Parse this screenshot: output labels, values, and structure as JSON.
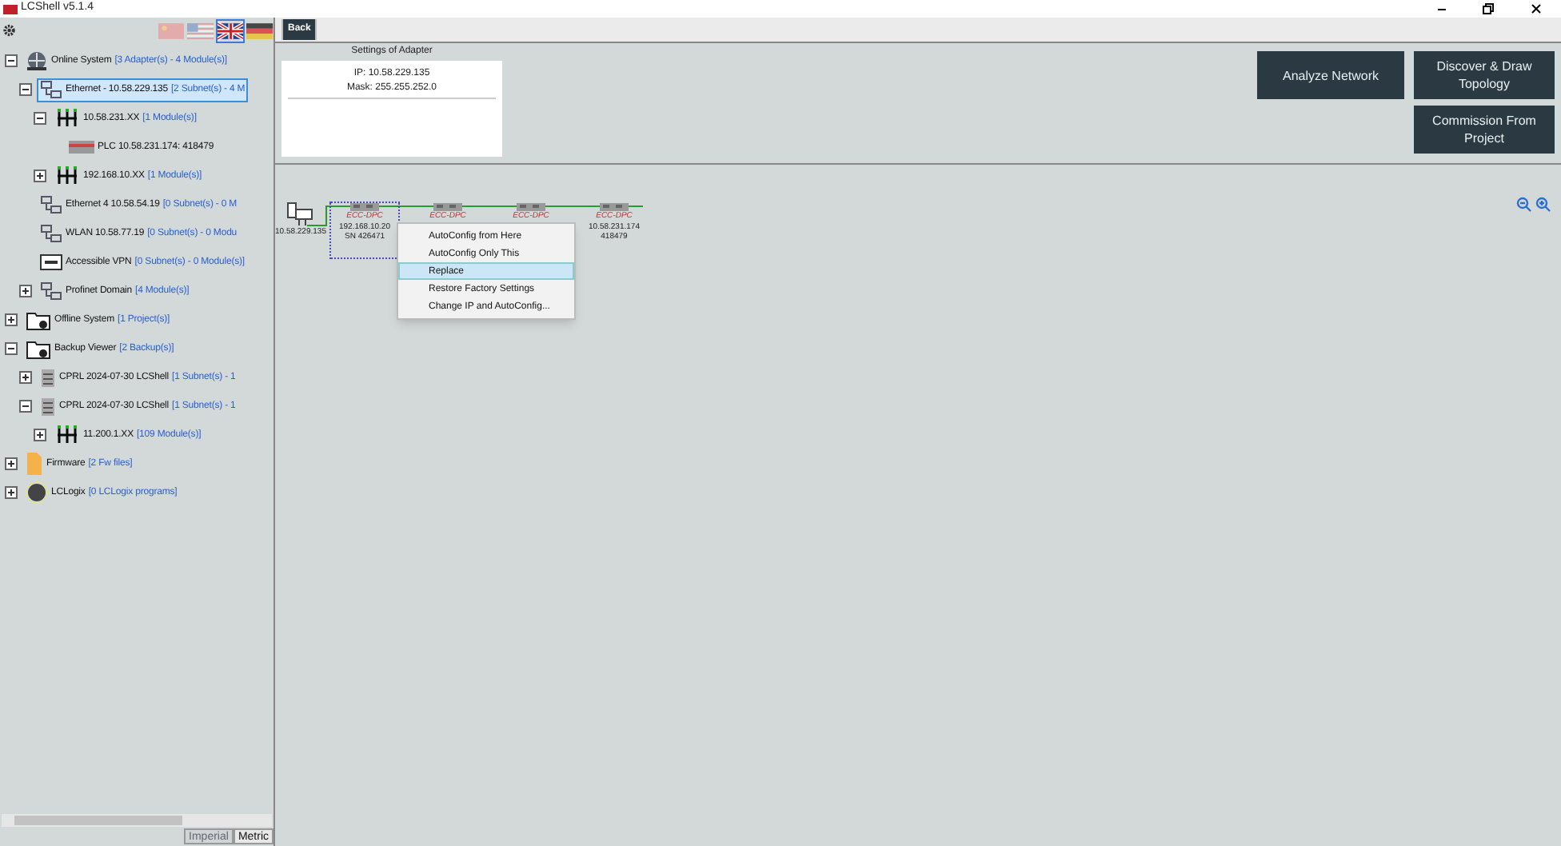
{
  "window": {
    "title": "LCShell v5.1.4"
  },
  "flags": [
    {
      "kind": "cn",
      "selected": false
    },
    {
      "kind": "us",
      "selected": false
    },
    {
      "kind": "uk",
      "selected": true
    },
    {
      "kind": "de",
      "selected": false
    }
  ],
  "tree": [
    {
      "label": "Online System",
      "info": "[3 Adapter(s) - 4 Module(s)]",
      "kind": "online",
      "expanded": true,
      "selected": false,
      "children": [
        {
          "label": "Ethernet - 10.58.229.135",
          "info": "[2 Subnet(s) - 4 M",
          "kind": "adapter",
          "expanded": true,
          "selected": true,
          "children": [
            {
              "label": "10.58.231.XX",
              "info": "[1 Module(s)]",
              "kind": "subnet",
              "expanded": true,
              "selected": false,
              "children": [
                {
                  "label": "PLC 10.58.231.174: 418479",
                  "kind": "plc",
                  "selected": false
                }
              ]
            },
            {
              "label": "192.168.10.XX",
              "info": "[1 Module(s)]",
              "kind": "subnet",
              "expanded": false,
              "selected": false
            }
          ]
        },
        {
          "label": "Ethernet 4   10.58.54.19",
          "info": "[0 Subnet(s) - 0 M",
          "kind": "adapter",
          "selected": false
        },
        {
          "label": "WLAN   10.58.77.19",
          "info": "[0 Subnet(s) - 0 Modu",
          "kind": "adapter",
          "selected": false
        },
        {
          "label": "Accessible VPN",
          "info": "[0 Subnet(s) - 0 Module(s)]",
          "kind": "vpn",
          "selected": false
        },
        {
          "label": "Profinet Domain",
          "info": "[4 Module(s)]",
          "kind": "adapter",
          "expanded": false,
          "selected": false
        }
      ]
    },
    {
      "label": "Offline System",
      "info": "[1 Project(s)]",
      "kind": "folder",
      "expanded": false,
      "selected": false
    },
    {
      "label": "Backup Viewer",
      "info": "[2 Backup(s)]",
      "kind": "folder",
      "expanded": true,
      "selected": false,
      "children": [
        {
          "label": "CPRL 2024-07-30 LCShell",
          "info": "[1 Subnet(s) - 1",
          "kind": "backup",
          "expanded": false,
          "selected": false
        },
        {
          "label": "CPRL 2024-07-30 LCShell",
          "info": "[1 Subnet(s) - 1",
          "kind": "backup",
          "expanded": true,
          "selected": false,
          "children": [
            {
              "label": "11.200.1.XX",
              "info": "[109 Module(s)]",
              "kind": "subnet",
              "expanded": false,
              "selected": false
            }
          ]
        }
      ]
    },
    {
      "label": "Firmware",
      "info": "[2 Fw files]",
      "kind": "firmware",
      "expanded": false,
      "selected": false
    },
    {
      "label": "LCLogix",
      "info": "[0 LCLogix programs]",
      "kind": "logix",
      "expanded": false,
      "selected": false
    }
  ],
  "units": [
    {
      "label": "Imperial",
      "selected": false
    },
    {
      "label": "Metric",
      "selected": true
    }
  ],
  "toolbar": {
    "back": "Back"
  },
  "adapter_settings": {
    "title": "Settings of Adapter",
    "ip": "IP: 10.58.229.135",
    "mask": "Mask: 255.255.252.0"
  },
  "actions": [
    {
      "label": "Analyze Network"
    },
    {
      "label": "Discover & Draw Topology"
    },
    {
      "label": "Commission From Project"
    }
  ],
  "topology": {
    "pc": {
      "label": "10.58.229.135"
    },
    "modules": [
      {
        "type": "ECC-DPC",
        "ip": "192.168.10.20",
        "sn": "SN 426471",
        "selected": true
      },
      {
        "type": "ECC-DPC",
        "selected": false
      },
      {
        "type": "ECC-DPC",
        "selected": false
      },
      {
        "type": "ECC-DPC",
        "ip": "10.58.231.174",
        "sn": "418479",
        "selected": false
      }
    ]
  },
  "context_menu": [
    {
      "label": "AutoConfig from Here",
      "selected": false
    },
    {
      "label": "AutoConfig Only This",
      "selected": false
    },
    {
      "label": "Replace",
      "selected": true
    },
    {
      "label": "Restore Factory Settings",
      "selected": false
    },
    {
      "label": "Change IP and AutoConfig...",
      "selected": false
    }
  ]
}
